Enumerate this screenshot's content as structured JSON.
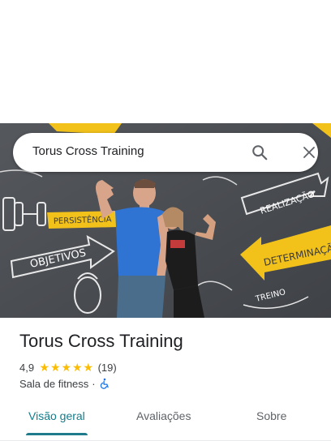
{
  "search": {
    "query": "Torus Cross Training",
    "search_icon": "search-icon",
    "close_icon": "close-icon"
  },
  "place": {
    "name": "Torus Cross Training",
    "rating": "4,9",
    "rating_stars": 5,
    "review_count": "(19)",
    "category": "Sala de fitness",
    "separator": "·",
    "accessibility_icon": "wheelchair-accessible-icon"
  },
  "tabs": [
    {
      "label": "Visão geral",
      "active": true
    },
    {
      "label": "Avaliações",
      "active": false
    },
    {
      "label": "Sobre",
      "active": false
    }
  ],
  "photo": {
    "wall_words": [
      "PERSISTÊNCIA",
      "OBJETIVOS",
      "REALIZAÇÃO",
      "DETERMINAÇÃO",
      "TREINO"
    ]
  },
  "colors": {
    "star": "#fbbc04",
    "active_tab": "#1f7a8c",
    "accessibility": "#1a73e8",
    "wall_yellow": "#f2c21b",
    "wall_gray": "#4a4d52"
  }
}
